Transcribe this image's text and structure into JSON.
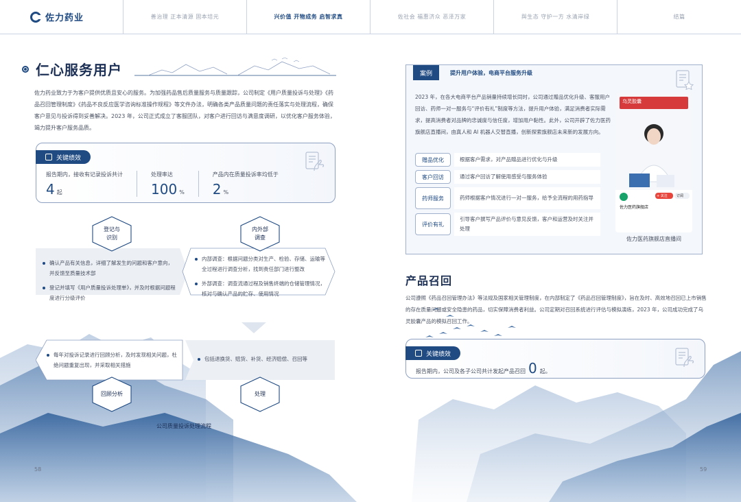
{
  "nav": {
    "brand": "佐力药业",
    "tabs": [
      {
        "label": "善治理 正本清源 固本培元",
        "active": false
      },
      {
        "label": "兴价值 开物成务 启智求真",
        "active": true
      },
      {
        "label": "佐社会 福惠济众 恶泽万家",
        "active": false
      },
      {
        "label": "與生态 守护一方 水清岸绿",
        "active": false
      },
      {
        "label": "结篇",
        "active": false
      }
    ]
  },
  "left": {
    "title": "仁心服务用户",
    "intro": "佐力药业致力于为客户提供优质且安心的服务。为加强药品售后质量服务与质量跟踪，公司制定《用户质量投诉与处理》《药品召回管理制度》《药品不良反应医学咨询标准操作规程》等文件办法，明确各类产品质量问题的责任落实与处理流程，确保客户意见与投诉得到妥善解决。2023 年，公司正式成立了客服团队，对客户进行回访与满意度调研，以优化客户服务体验，竭力提升客户服务品质。",
    "kpi": {
      "tag": "关键绩效",
      "items": [
        {
          "label": "报告期内，接收有记录投诉共计",
          "value": "4",
          "unit": "起"
        },
        {
          "label": "处理率达",
          "value": "100",
          "unit": "%"
        },
        {
          "label": "产品内在质量投诉率均低于",
          "value": "2",
          "unit": "%"
        }
      ]
    },
    "flow": {
      "steps": [
        "登记与识别",
        "内外部调查",
        "回顾分析",
        "处理"
      ],
      "step_lines": [
        [
          "登记与",
          "识别"
        ],
        [
          "内外部",
          "调查"
        ],
        [
          "回顾分析"
        ],
        [
          "处理"
        ]
      ],
      "box1": [
        "确认产品有关信息，详细了解发生的问题和客户意向，并反馈至质量技术部",
        "登记并填写《用户质量投诉处理单》，并及时根据问题程度进行分级评价"
      ],
      "box2": [
        "内部调查：根据问题分类对生产、检验、存储、运输等全过程进行调查分析，找到责任部门进行整改",
        "外部调查：调查流通过程及销售终端的仓储管理情况，核对与确认产品的贮存、使用情况"
      ],
      "box3": [
        "每年对投诉记录进行回顾分析，及时发现相关问题，杜绝问题重复出现，并采取相关措施"
      ],
      "box4": [
        "包括退换货、赔货、补货、经济赔偿、召回等"
      ],
      "caption": "公司质量投诉处理流程"
    },
    "page_number": "58"
  },
  "right": {
    "case": {
      "tag": "案例",
      "headline": "提升用户体验，电商平台服务升级",
      "text": "2023 年，在各大电商平台产品销量持续增长同时，公司通过赠品优化升级、客服用户回访、药师一对一服务与“评价有礼”制度等方法，提升用户体验，满足消费者实际需求，提高消费者对品牌的忠诚度与信任度，增加用户黏性。此外，公司开辟了佐力医药旗舰店直播间，由真人和 AI 机器人交替直播，创新探索旗舰店未来新的发展方向。",
      "rows": [
        {
          "label": "赠品优化",
          "text": "根据客户需求，对产品赠品进行优化与升级"
        },
        {
          "label": "客户回访",
          "text": "通过客户回访了解使用感受与服务体验"
        },
        {
          "label": "药师服务",
          "text": "药师根据客户情况进行一对一服务，给予全流程的用药指导"
        },
        {
          "label": "评价有礼",
          "text": "引导客户撰写产品评价与意见反馈，客户和运营及时关注并处理"
        }
      ],
      "screenshot": {
        "banner": "乌灵胶囊",
        "shop_name": "佐力医药旗舰店",
        "follow": "+ 关注",
        "subscribe": "订阅"
      },
      "image_caption": "佐力医药旗舰店直播间"
    },
    "recall": {
      "title": "产品召回",
      "text": "公司遵照《药品召回管理办法》等法规及国家相关管理制度，在内部制定了《药品召回管理制度》，旨在及时、高效地召回已上市销售的存在质量问题或安全隐患的药品，切实保障消费者利益。公司定期对召回系统进行评估与模拟演练，2023 年，公司成功完成了乌灵胶囊产品的模拟召回工作。",
      "kpi": {
        "tag": "关键绩效",
        "label": "报告期内，公司及各子公司共计发起产品召回",
        "value": "0",
        "unit": "起。"
      }
    },
    "page_number": "59"
  },
  "colors": {
    "primary": "#1f4a82",
    "title": "#1c2f55",
    "text": "#4b5363",
    "border": "#8ea0c2",
    "mountain": "#5f86b5"
  }
}
